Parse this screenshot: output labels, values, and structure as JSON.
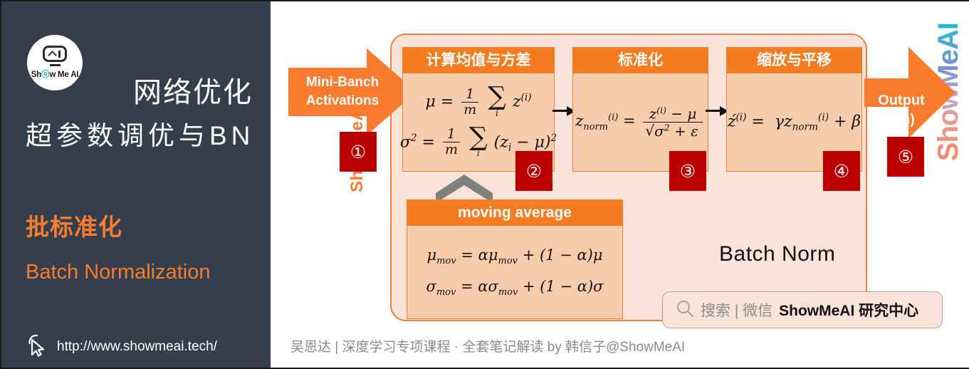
{
  "sidebar": {
    "logo": {
      "icon": "show-me-ai-robot-logo",
      "text_before": "Sh",
      "text_dot": "ⓞ",
      "text_after": "w Me AI"
    },
    "title_line1": "网络优化",
    "title_line2": "超参数调优与BN",
    "accent_line1": "批标准化",
    "accent_line2": "Batch Normalization",
    "url": "http://www.showmeai.tech/",
    "cursor_icon": "pointer-cursor-icon"
  },
  "diagram": {
    "container_label": "Batch Norm",
    "vertical_left_watermark": "ShowMeAI",
    "vertical_right_watermark": "ShowMeAI",
    "input_arrow": {
      "label_line1": "Mini-Banch",
      "label_line2": "Activations",
      "badge": "①"
    },
    "output_arrow": {
      "label_line1": "Output",
      "label_line2": "(bn)",
      "badge": "⑤"
    },
    "steps": [
      {
        "id": "compute-mean-variance",
        "header": "计算均值与方差",
        "badge": "②",
        "formulas": [
          "μ = (1/m) ∑ᵢ z⁽ⁱ⁾",
          "σ² = (1/m) ∑ᵢ (zᵢ − μ)²"
        ]
      },
      {
        "id": "normalize",
        "header": "标准化",
        "badge": "③",
        "formulas": [
          "zₙₒᵣₘ⁽ⁱ⁾ = (z⁽ⁱ⁾ − μ) / √(σ² + ε)"
        ]
      },
      {
        "id": "scale-and-shift",
        "header": "缩放与平移",
        "badge": "④",
        "formulas": [
          "ẑ⁽ⁱ⁾ = γ zₙₒᵣₘ⁽ⁱ⁾ + β"
        ]
      }
    ],
    "moving_average": {
      "id": "moving-average",
      "header": "moving average",
      "formulas": [
        "μₘₒᵥ = αμₘₒᵥ + (1 − α)μ",
        "σₘₒᵥ = ασₘₒᵥ + (1 − α)σ"
      ]
    }
  },
  "search": {
    "icon": "search-icon",
    "placeholder": "搜索 | 微信",
    "brand": "ShowMeAI 研究中心"
  },
  "footer": {
    "caption": "吴恩达 | 深度学习专项课程 · 全套笔记解读  by 韩信子@ShowMeAI"
  },
  "colors": {
    "sidebar_bg": "#343E4C",
    "accent_orange": "#F97B2E",
    "header_orange": "#F47B20",
    "box_fill": "#F7CCAD",
    "container_bg": "#F9E2D7",
    "badge_red": "#BB0000"
  }
}
